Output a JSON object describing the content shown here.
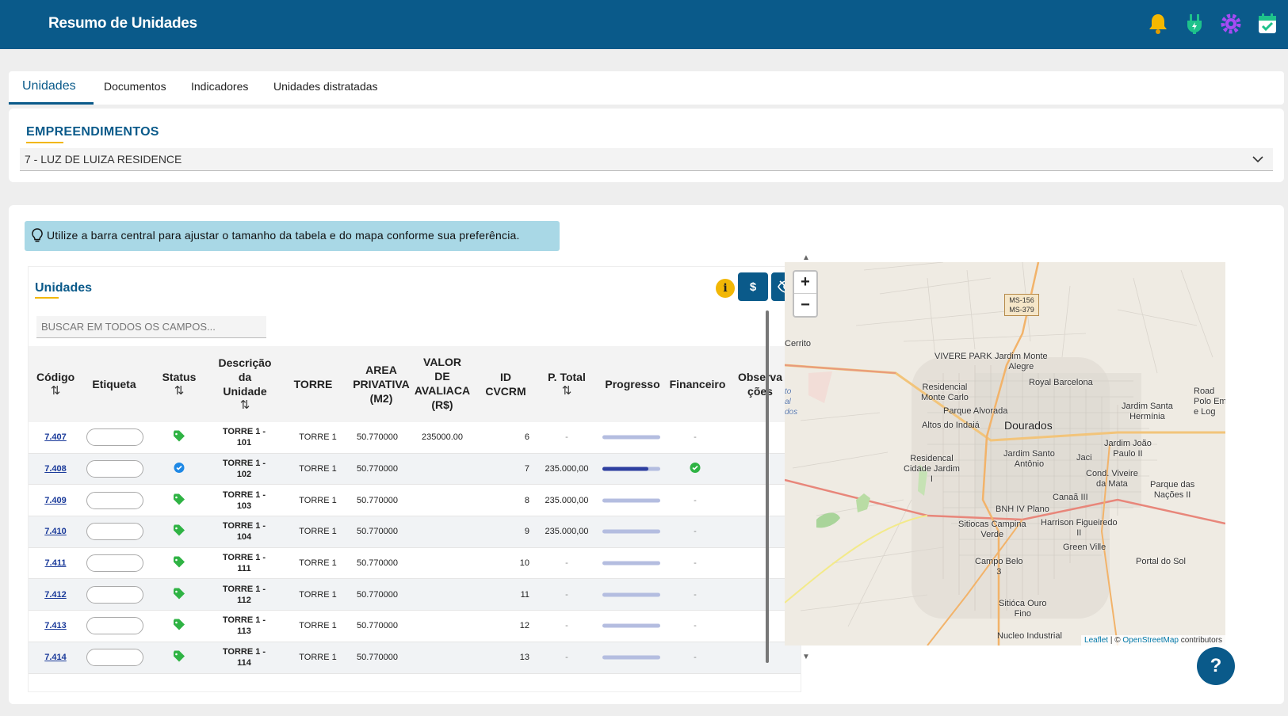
{
  "header": {
    "title": "Resumo de Unidades",
    "icons": [
      "bell-icon",
      "plug-icon",
      "gear-icon",
      "calendar-check-icon"
    ]
  },
  "tabs": [
    {
      "label": "Unidades",
      "active": true
    },
    {
      "label": "Documentos",
      "active": false
    },
    {
      "label": "Indicadores",
      "active": false
    },
    {
      "label": "Unidades distratadas",
      "active": false
    }
  ],
  "empreendimentos": {
    "title": "EMPREENDIMENTOS",
    "selected": "7 - LUZ DE LUIZA RESIDENCE"
  },
  "tip": "Utilize a barra central para ajustar o tamanho da tabela e do mapa conforme sua preferência.",
  "unidades": {
    "title": "Unidades",
    "info_label": "i",
    "money_label": "$",
    "search_placeholder": "BUSCAR EM TODOS OS CAMPOS...",
    "columns": {
      "codigo": "Código",
      "etiqueta": "Etiqueta",
      "status": "Status",
      "descricao": [
        "Descrição",
        "da",
        "Unidade"
      ],
      "torre": "TORRE",
      "area": [
        "AREA",
        "PRIVATIVA",
        "(M2)"
      ],
      "valor": [
        "VALOR",
        "DE",
        "AVALIACA",
        "(R$)"
      ],
      "idcvcrm": [
        "ID",
        "CVCRM"
      ],
      "ptotal": "P. Total",
      "progresso": "Progresso",
      "financeiro": "Financeiro",
      "observacoes": [
        "Observa",
        "ções"
      ],
      "sort_symbol": "⇅"
    },
    "rows": [
      {
        "codigo": "7.407",
        "status": "tag",
        "desc1": "TORRE 1 -",
        "desc2": "101",
        "torre": "TORRE 1",
        "area": "50.770000",
        "valor": "235000.00",
        "id": "6",
        "ptotal": "-",
        "progress": 0,
        "financeiro": "-"
      },
      {
        "codigo": "7.408",
        "status": "check",
        "desc1": "TORRE 1 -",
        "desc2": "102",
        "torre": "TORRE 1",
        "area": "50.770000",
        "valor": "",
        "id": "7",
        "ptotal": "235.000,00",
        "progress": 0.8,
        "financeiro": "ok"
      },
      {
        "codigo": "7.409",
        "status": "tag",
        "desc1": "TORRE 1 -",
        "desc2": "103",
        "torre": "TORRE 1",
        "area": "50.770000",
        "valor": "",
        "id": "8",
        "ptotal": "235.000,00",
        "progress": 0,
        "financeiro": "-"
      },
      {
        "codigo": "7.410",
        "status": "tag",
        "desc1": "TORRE 1 -",
        "desc2": "104",
        "torre": "TORRE 1",
        "area": "50.770000",
        "valor": "",
        "id": "9",
        "ptotal": "235.000,00",
        "progress": 0,
        "financeiro": "-"
      },
      {
        "codigo": "7.411",
        "status": "tag",
        "desc1": "TORRE 1 -",
        "desc2": "111",
        "torre": "TORRE 1",
        "area": "50.770000",
        "valor": "",
        "id": "10",
        "ptotal": "-",
        "progress": 0,
        "financeiro": "-"
      },
      {
        "codigo": "7.412",
        "status": "tag",
        "desc1": "TORRE 1 -",
        "desc2": "112",
        "torre": "TORRE 1",
        "area": "50.770000",
        "valor": "",
        "id": "11",
        "ptotal": "-",
        "progress": 0,
        "financeiro": "-"
      },
      {
        "codigo": "7.413",
        "status": "tag",
        "desc1": "TORRE 1 -",
        "desc2": "113",
        "torre": "TORRE 1",
        "area": "50.770000",
        "valor": "",
        "id": "12",
        "ptotal": "-",
        "progress": 0,
        "financeiro": "-"
      },
      {
        "codigo": "7.414",
        "status": "tag",
        "desc1": "TORRE 1 -",
        "desc2": "114",
        "torre": "TORRE 1",
        "area": "50.770000",
        "valor": "",
        "id": "13",
        "ptotal": "-",
        "progress": 0,
        "financeiro": "-"
      }
    ]
  },
  "map": {
    "zoom_in": "+",
    "zoom_out": "−",
    "shield": [
      "MS-156",
      "MS-379"
    ],
    "labels": {
      "cerrito": "Cerrito",
      "vivere": "VIVERE PARK",
      "jardim_monte_alegre": [
        "Jardim Monte",
        "Alegre"
      ],
      "royal": "Royal Barcelona",
      "res_monte_carlo": [
        "Residencial",
        "Monte Carlo"
      ],
      "parque_alvorada": "Parque Alvorada",
      "altos": "Altos do Indaiá",
      "dourados": "Dourados",
      "jardim_santa_hermina": [
        "Jardim Santa",
        "Hermínia"
      ],
      "road_polo": [
        "Road",
        "Polo Em",
        "e Log"
      ],
      "jardim_joao_paulo": [
        "Jardim João",
        "Paulo II"
      ],
      "res_cidade_jardim": [
        "Residencal",
        "Cidade Jardim",
        "I"
      ],
      "jardim_santo_antonio": [
        "Jardim Santo",
        "Antônio"
      ],
      "jaci": "Jaci",
      "cond_viveire": [
        "Cond. Viveire",
        "da Mata"
      ],
      "parque_nacoes": [
        "Parque das",
        "Nações II"
      ],
      "canaa": "Canaã III",
      "bnh": "BNH IV Plano",
      "sitiocas_campina": [
        "Sitiocas Campina",
        "Verde"
      ],
      "harrison": [
        "Harrison Figueiredo",
        "II"
      ],
      "green_ville": "Green Ville",
      "campo_belo": [
        "Campo Belo",
        "3"
      ],
      "portal_sol": "Portal do Sol",
      "sitioca_ouro": [
        "Sitióca Ouro",
        "Fino"
      ],
      "nucleo": "Nucleo Industrial",
      "side_fragment": [
        "to",
        "al",
        "dos"
      ]
    },
    "attribution": {
      "leaflet": "Leaflet",
      "sep": " | © ",
      "osm": "OpenStreetMap",
      "contributors": " contributors"
    }
  },
  "help_label": "?",
  "colors": {
    "primary": "#0a5a8a",
    "accent": "#f2b705",
    "tip": "#a9d8e6",
    "status_green": "#2fb344",
    "status_blue": "#1e88e5"
  }
}
